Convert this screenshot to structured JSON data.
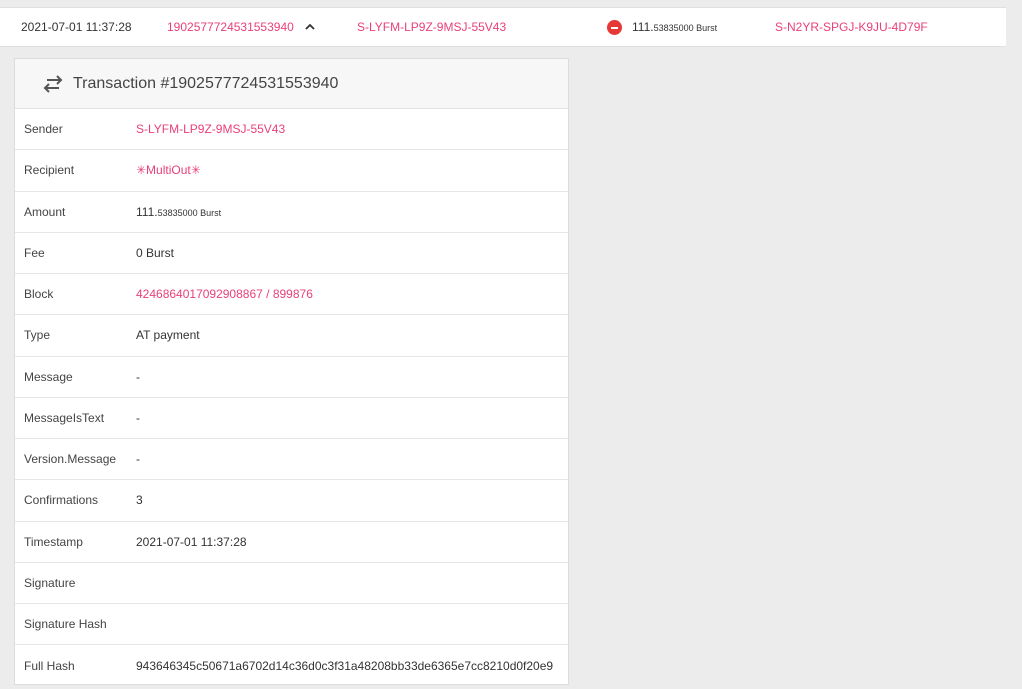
{
  "list_row": {
    "date": "2021-07-01 11:37:28",
    "tx_id": "1902577724531553940",
    "sender": "S-LYFM-LP9Z-9MSJ-55V43",
    "amount_main": "111.",
    "amount_fraction": "53835000 Burst",
    "recipient": "S-N2YR-SPGJ-K9JU-4D79F"
  },
  "card": {
    "title": "Transaction #1902577724531553940",
    "rows": [
      {
        "label": "Sender",
        "value": "S-LYFM-LP9Z-9MSJ-55V43"
      },
      {
        "label": "Recipient",
        "value": "✳MultiOut✳"
      },
      {
        "label": "Amount",
        "value_main": "111.",
        "value_fraction": "53835000 Burst"
      },
      {
        "label": "Fee",
        "value": "0 Burst"
      },
      {
        "label": "Block",
        "value_block_id": "4246864017092908867",
        "value_sep": " / ",
        "value_height": "899876"
      },
      {
        "label": "Type",
        "value": "AT payment"
      },
      {
        "label": "Message",
        "value": "-"
      },
      {
        "label": "MessageIsText",
        "value": "-"
      },
      {
        "label": "Version.Message",
        "value": "-"
      },
      {
        "label": "Confirmations",
        "value": "3"
      },
      {
        "label": "Timestamp",
        "value": "2021-07-01 11:37:28"
      },
      {
        "label": "Signature",
        "value": ""
      },
      {
        "label": "Signature Hash",
        "value": ""
      },
      {
        "label": "Full Hash",
        "value": "943646345c50671a6702d14c36d0c3f31a48208bb33de6365e7cc8210d0f20e9"
      }
    ]
  },
  "icons": {
    "collapse": "chevron-up-icon",
    "direction": "minus-circle-icon",
    "header": "swap-arrows-icon"
  },
  "colors": {
    "link": "#e9407a",
    "outgoing": "#e53935"
  }
}
